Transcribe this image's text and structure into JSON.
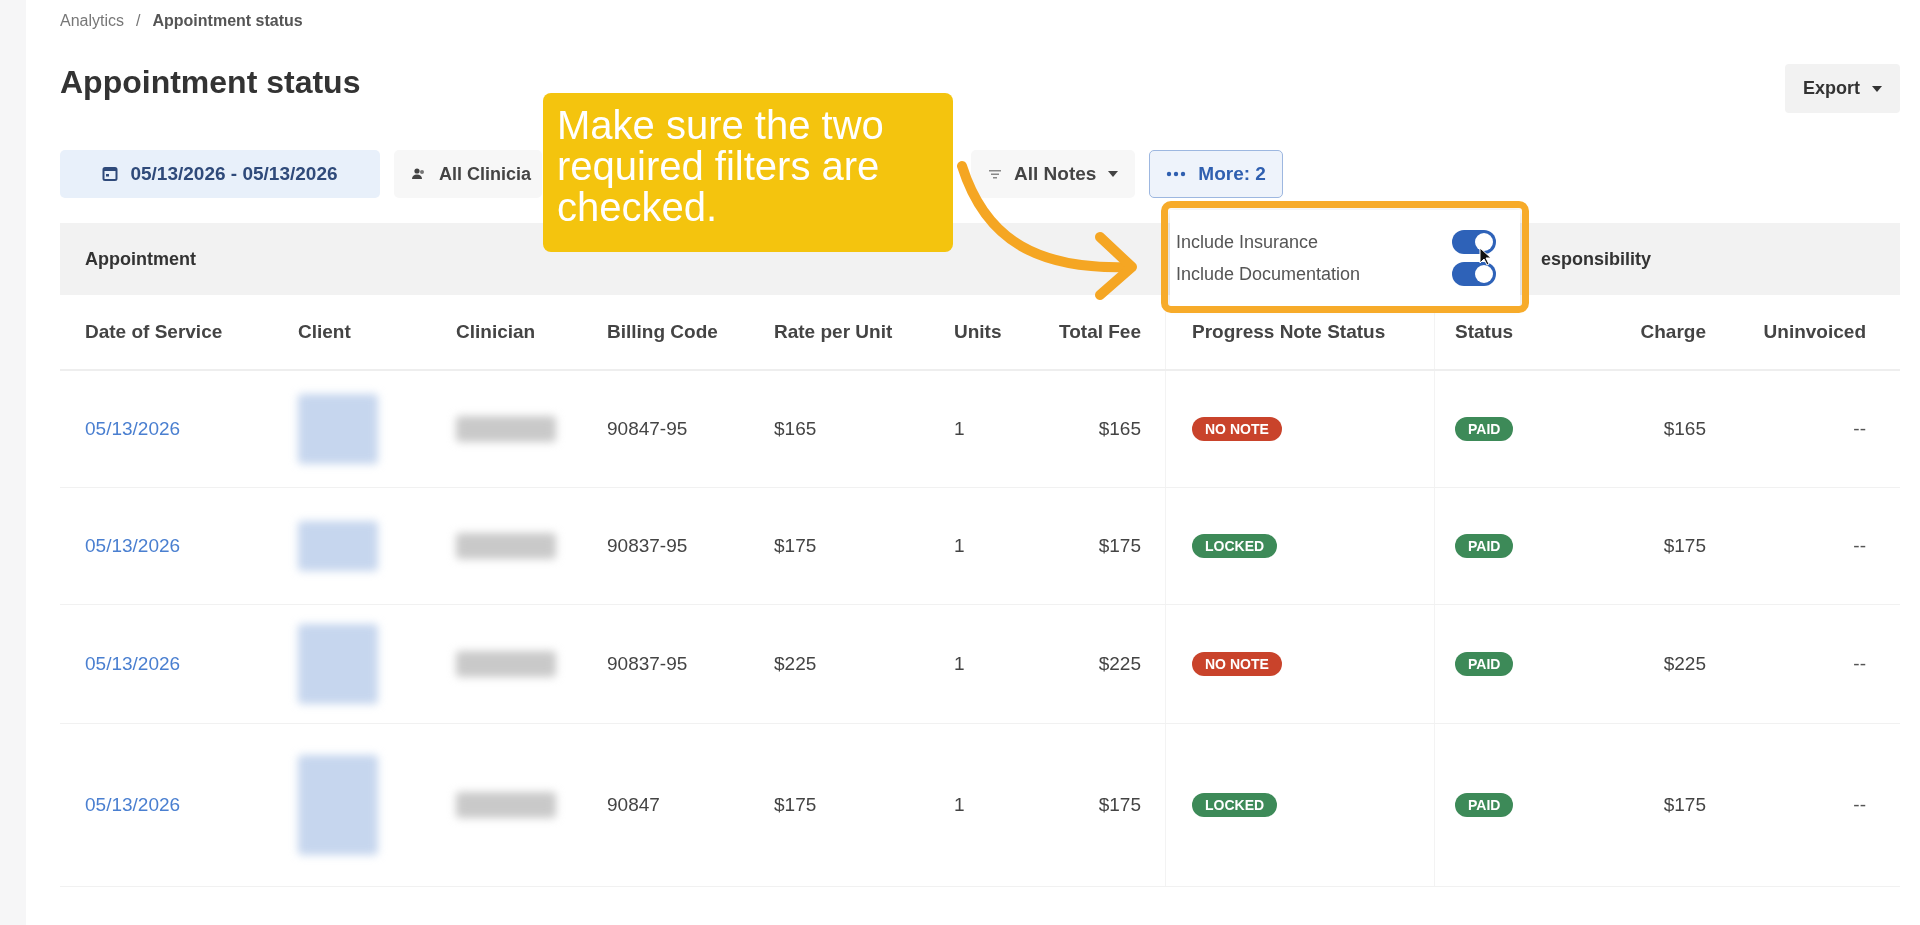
{
  "breadcrumb": [
    {
      "label": "Analytics"
    },
    {
      "label": "Appointment status"
    }
  ],
  "breadcrumb_separator": "/",
  "title": "Appointment status",
  "export_button": "Export",
  "filters": [
    {
      "kind": "date",
      "label": "05/13/2026 - 05/13/2026",
      "active": true
    },
    {
      "kind": "clinician",
      "label": "All Clinicia",
      "active": false
    },
    {
      "kind": "notes",
      "label": "All Notes",
      "active": false
    },
    {
      "kind": "more",
      "label": "More: 2",
      "active": true
    }
  ],
  "column_groups": [
    {
      "label": "Appointment"
    },
    {
      "label": "esponsibility"
    }
  ],
  "columns": [
    {
      "label": "Date of Service"
    },
    {
      "label": "Client"
    },
    {
      "label": "Clinician"
    },
    {
      "label": "Billing Code"
    },
    {
      "label": "Rate per Unit"
    },
    {
      "label": "Units"
    },
    {
      "label": "Total Fee"
    },
    {
      "label": "Progress Note Status"
    },
    {
      "label": "Status"
    },
    {
      "label": "Charge"
    },
    {
      "label": "Uninvoiced"
    }
  ],
  "rows": [
    {
      "date": "05/13/2026",
      "billing_code": "90847-95",
      "rate": "$165",
      "units": "1",
      "total_fee": "$165",
      "note_status": {
        "label": "NO NOTE",
        "kind": "danger"
      },
      "status": {
        "label": "PAID",
        "kind": "success"
      },
      "charge": "$165",
      "uninvoiced": "--"
    },
    {
      "date": "05/13/2026",
      "billing_code": "90837-95",
      "rate": "$175",
      "units": "1",
      "total_fee": "$175",
      "note_status": {
        "label": "LOCKED",
        "kind": "success"
      },
      "status": {
        "label": "PAID",
        "kind": "success"
      },
      "charge": "$175",
      "uninvoiced": "--"
    },
    {
      "date": "05/13/2026",
      "billing_code": "90837-95",
      "rate": "$225",
      "units": "1",
      "total_fee": "$225",
      "note_status": {
        "label": "NO NOTE",
        "kind": "danger"
      },
      "status": {
        "label": "PAID",
        "kind": "success"
      },
      "charge": "$225",
      "uninvoiced": "--"
    },
    {
      "date": "05/13/2026",
      "billing_code": "90847",
      "rate": "$175",
      "units": "1",
      "total_fee": "$175",
      "note_status": {
        "label": "LOCKED",
        "kind": "success"
      },
      "status": {
        "label": "PAID",
        "kind": "success"
      },
      "charge": "$175",
      "uninvoiced": "--"
    }
  ],
  "more_popup": {
    "options": [
      {
        "label": "Include Insurance",
        "on": true
      },
      {
        "label": "Include Documentation",
        "on": true
      }
    ]
  },
  "callout": "Make sure the two required filters are checked."
}
